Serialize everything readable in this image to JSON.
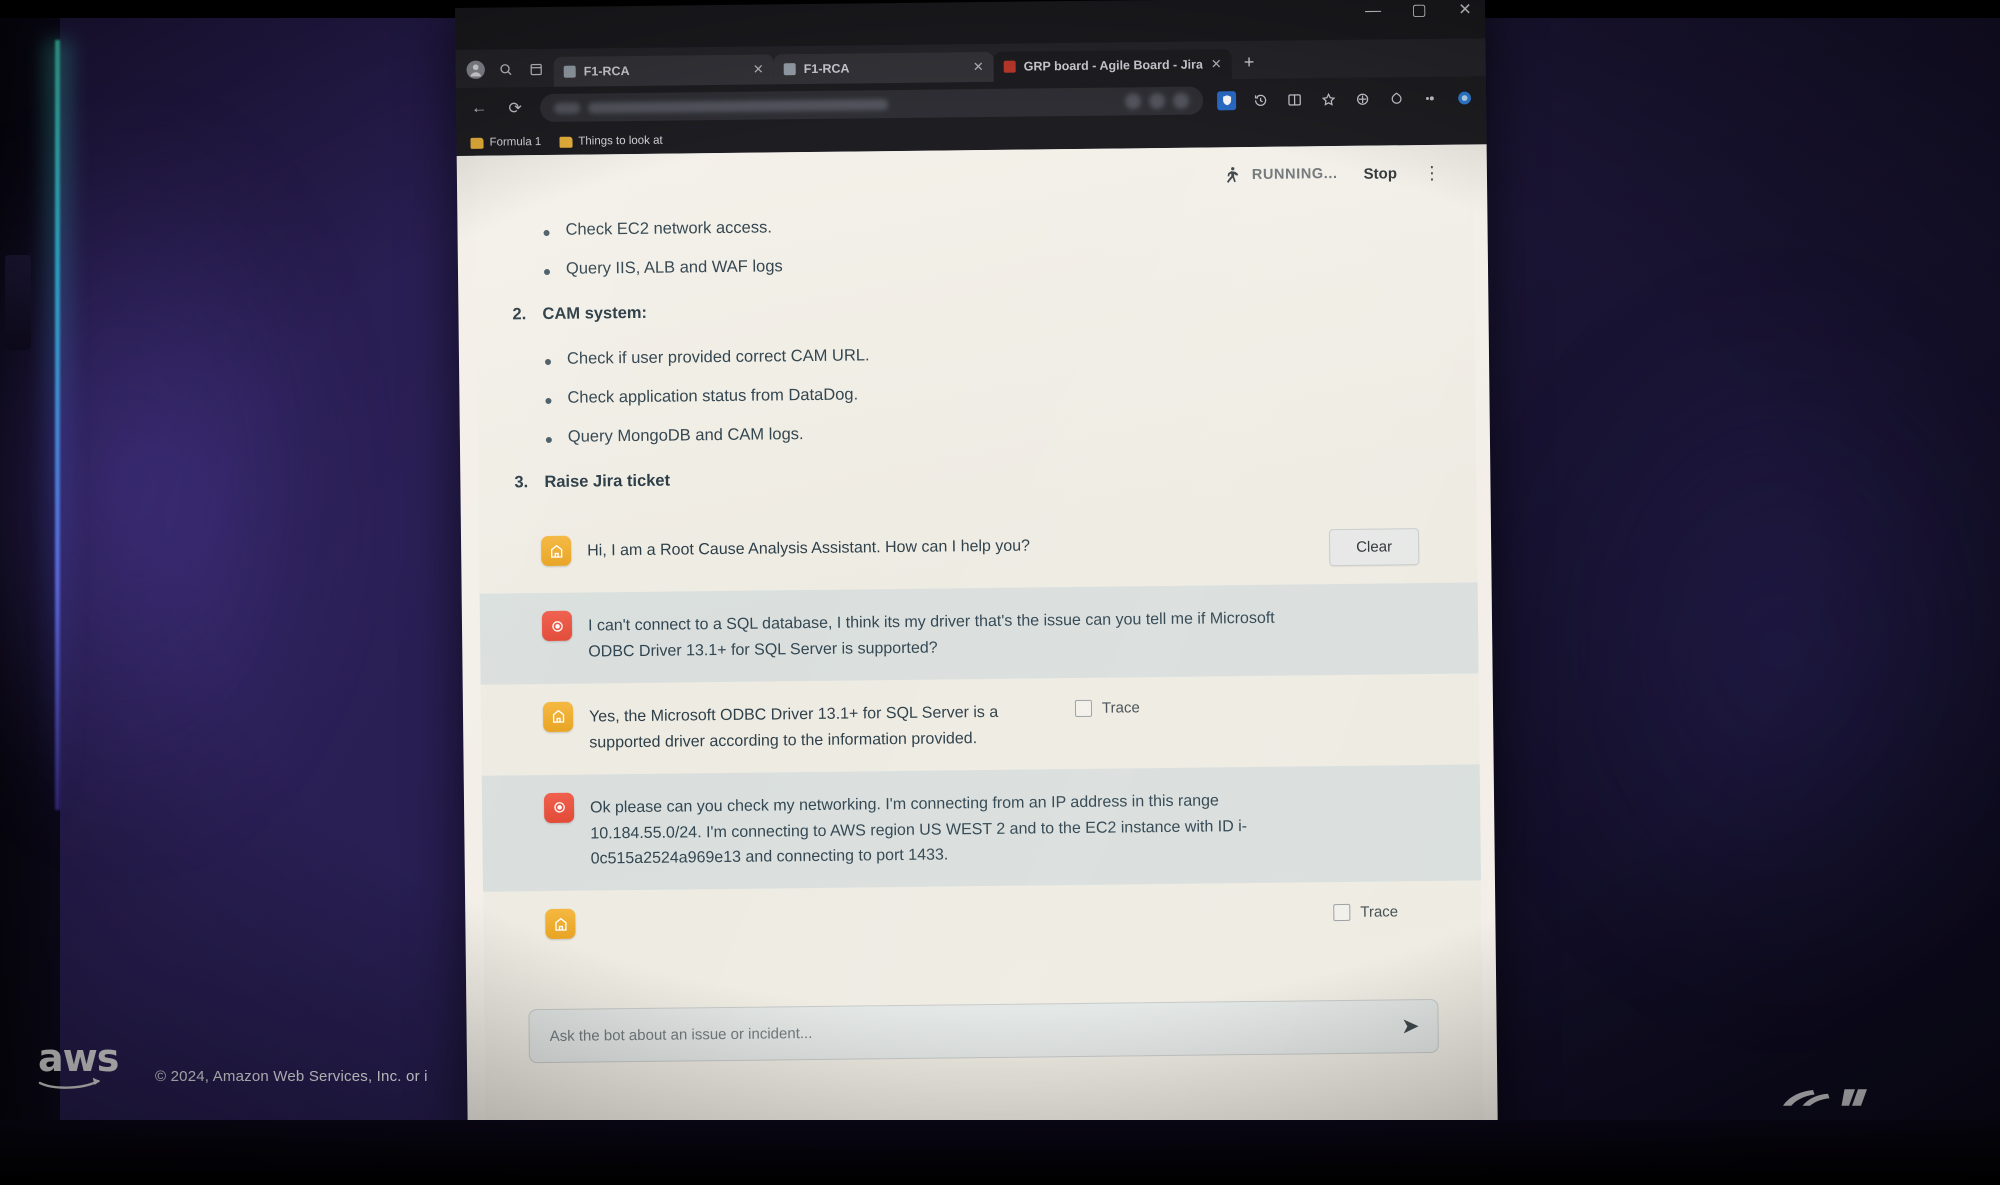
{
  "window": {
    "controls": [
      "minimize",
      "maximize",
      "close"
    ],
    "minimize_glyph": "—",
    "maximize_glyph": "▢",
    "close_glyph": "✕"
  },
  "browser": {
    "profile_icon": "profile-avatar-icon",
    "tabs": [
      {
        "title": "F1-RCA",
        "state": "inactive",
        "close_glyph": "✕",
        "favicon_color": "#9aa3ad"
      },
      {
        "title": "F1-RCA",
        "state": "inactive",
        "close_glyph": "✕",
        "favicon_color": "#9aa3ad"
      },
      {
        "title": "GRP board - Agile Board - Jira",
        "state": "active",
        "close_glyph": "✕",
        "favicon_color": "#c0392b"
      }
    ],
    "new_tab_glyph": "+",
    "nav": {
      "back_glyph": "←",
      "reload_glyph": "⟳",
      "address_value": "",
      "address_placeholder": ""
    },
    "toolbar_icons": [
      "shield-icon",
      "history-icon",
      "split-screen-icon",
      "favorite-star-icon",
      "collections-icon",
      "browser-essentials-icon",
      "extensions-icon",
      "copilot-icon"
    ],
    "bookmarks": [
      {
        "label": "Formula 1"
      },
      {
        "label": "Things to look at"
      }
    ]
  },
  "app": {
    "status": {
      "run_label": "RUNNING...",
      "stop_label": "Stop",
      "menu_glyph": "⋮"
    },
    "document": {
      "blocks": [
        {
          "kind": "bullet",
          "text": "Check EC2 network access."
        },
        {
          "kind": "bullet",
          "text": "Query IIS, ALB and WAF logs"
        },
        {
          "kind": "numbered",
          "num": "2.",
          "text": "CAM system:"
        },
        {
          "kind": "bullet",
          "text": "Check if user provided correct CAM URL."
        },
        {
          "kind": "bullet",
          "text": "Check application status from DataDog."
        },
        {
          "kind": "bullet",
          "text": "Query MongoDB and CAM logs."
        },
        {
          "kind": "numbered",
          "num": "3.",
          "text": "Raise Jira ticket"
        }
      ]
    },
    "chat": {
      "clear_label": "Clear",
      "trace_label": "Trace",
      "messages": [
        {
          "role": "bot",
          "text": "Hi, I am a Root Cause Analysis Assistant. How can I help you?",
          "action": "clear"
        },
        {
          "role": "user",
          "text": "I can't connect to a SQL database, I think its my driver that's the issue can you tell me if Microsoft ODBC Driver 13.1+ for SQL Server is supported?"
        },
        {
          "role": "bot",
          "text": "Yes, the Microsoft ODBC Driver 13.1+ for SQL Server is a supported driver according to the information provided.",
          "action": "trace"
        },
        {
          "role": "user",
          "text": "Ok please can you check my networking. I'm connecting from an IP address in this range 10.184.55.0/24. I'm connecting to AWS region US WEST 2 and to the EC2 instance with ID i-0c515a2524a969e13 and connecting to port 1433."
        },
        {
          "role": "bot",
          "text": "",
          "action": "trace"
        }
      ]
    },
    "composer": {
      "value": "",
      "placeholder": "Ask the bot about an issue or incident...",
      "send_glyph": "➤"
    }
  },
  "footer": {
    "aws_wordmark": "aws",
    "copyright": "© 2024, Amazon Web Services, Inc. or i"
  },
  "colors": {
    "accent_orange": "#f0a828",
    "accent_red": "#e8503c",
    "page_bg": "#f0ece4",
    "chrome_dark": "#1e1e22",
    "wall_purple": "#2b2057"
  }
}
